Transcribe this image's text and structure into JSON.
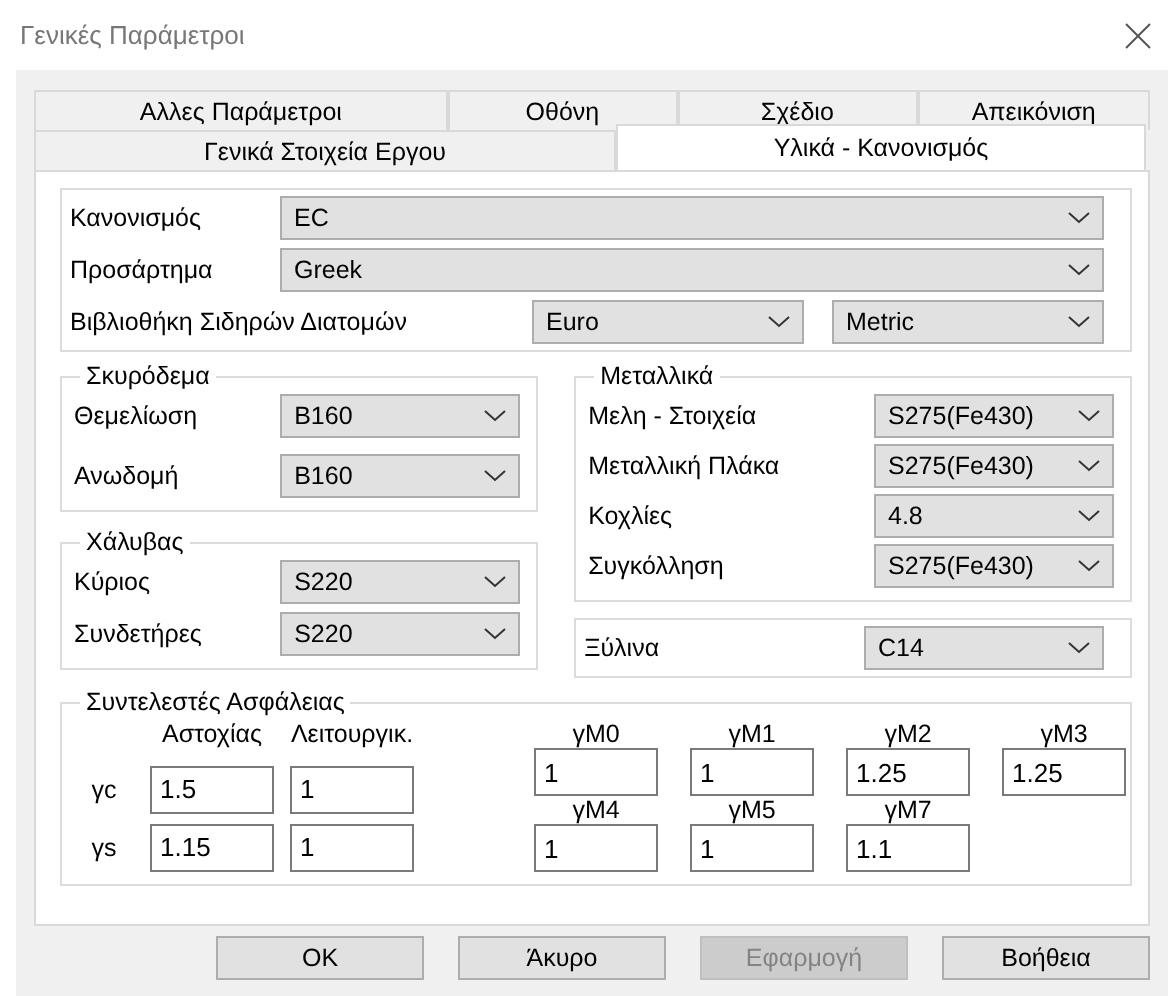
{
  "window": {
    "title": "Γενικές Παράμετροι"
  },
  "tabs": [
    [
      {
        "label": "Αλλες Παράμετροι",
        "selected": false
      },
      {
        "label": "Οθόνη",
        "selected": false
      },
      {
        "label": "Σχέδιο",
        "selected": false
      },
      {
        "label": "Απεικόνιση",
        "selected": false
      }
    ],
    [
      {
        "label": "Γενικά Στοιχεία Εργου",
        "selected": false
      },
      {
        "label": "Υλικά - Κανονισμός",
        "selected": true
      }
    ]
  ],
  "code": {
    "fields": [
      {
        "label": "Κανονισμός",
        "value": "EC"
      },
      {
        "label": "Προσάρτημα",
        "value": "Greek"
      }
    ],
    "library": {
      "label": "Βιβλιοθήκη Σιδηρών Διατομών",
      "values": [
        "Euro",
        "Metric"
      ]
    }
  },
  "concrete": {
    "title": "Σκυρόδεμα",
    "fields": [
      {
        "label": "Θεμελίωση",
        "value": "B160"
      },
      {
        "label": "Ανωδομή",
        "value": "B160"
      }
    ]
  },
  "steel": {
    "title": "Χάλυβας",
    "fields": [
      {
        "label": "Κύριος",
        "value": "S220"
      },
      {
        "label": "Συνδετήρες",
        "value": "S220"
      }
    ]
  },
  "metal": {
    "title": "Μεταλλικά",
    "fields": [
      {
        "label": "Μελη - Στοιχεία",
        "value": "S275(Fe430)"
      },
      {
        "label": "Μεταλλική Πλάκα",
        "value": "S275(Fe430)"
      },
      {
        "label": "Κοχλίες",
        "value": "4.8"
      },
      {
        "label": "Συγκόλληση",
        "value": "S275(Fe430)"
      }
    ]
  },
  "timber": {
    "fields": [
      {
        "label": "Ξύλινα",
        "value": "C14"
      }
    ]
  },
  "safety": {
    "title": "Συντελεστές Ασφάλειας",
    "columns": [
      "Αστοχίας",
      "Λειτουργικ."
    ],
    "rows": [
      {
        "label": "γc",
        "values": [
          "1.5",
          "1"
        ]
      },
      {
        "label": "γs",
        "values": [
          "1.15",
          "1"
        ]
      }
    ],
    "factors": [
      [
        {
          "label": "γM0",
          "value": "1"
        },
        {
          "label": "γM1",
          "value": "1"
        },
        {
          "label": "γM2",
          "value": "1.25"
        },
        {
          "label": "γM3",
          "value": "1.25"
        }
      ],
      [
        {
          "label": "γM4",
          "value": "1"
        },
        {
          "label": "γM5",
          "value": "1"
        },
        {
          "label": "γM7",
          "value": "1.1"
        }
      ]
    ]
  },
  "buttons": [
    {
      "label": "OK",
      "disabled": false
    },
    {
      "label": "Άκυρο",
      "disabled": false
    },
    {
      "label": "Εφαρμογή",
      "disabled": true
    },
    {
      "label": "Βοήθεια",
      "disabled": false
    }
  ]
}
